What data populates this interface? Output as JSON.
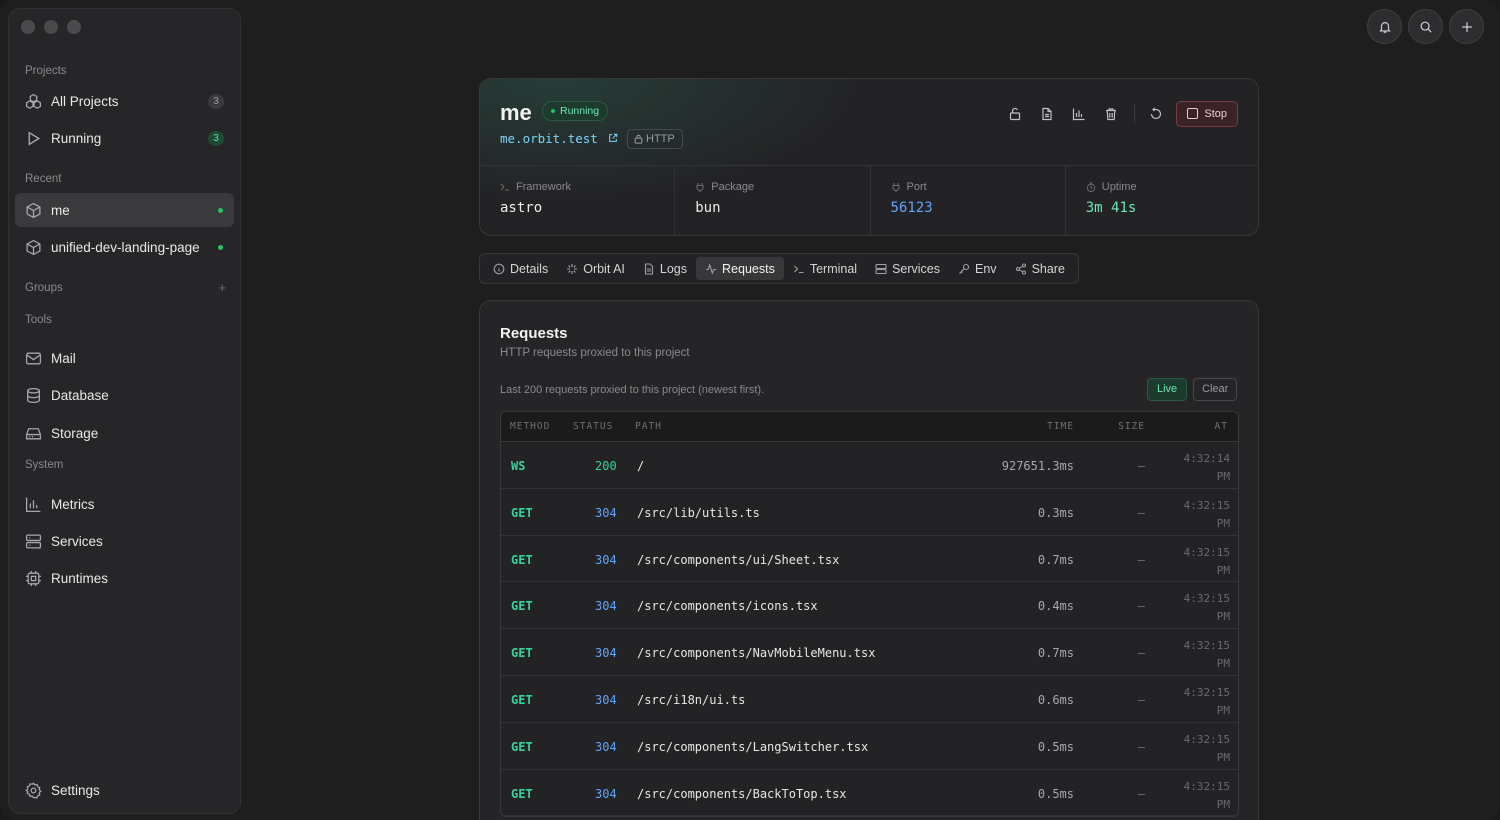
{
  "sidebar": {
    "sections": {
      "projects": "Projects",
      "recent": "Recent",
      "groups": "Groups",
      "tools": "Tools",
      "system": "System"
    },
    "projects": [
      {
        "label": "All Projects",
        "count": "3",
        "icon": "cubes-icon"
      },
      {
        "label": "Running",
        "count": "3",
        "icon": "play-icon"
      }
    ],
    "recent": [
      {
        "label": "me",
        "icon": "package-icon",
        "status": "running"
      },
      {
        "label": "unified-dev-landing-page",
        "icon": "package-icon",
        "status": "running"
      }
    ],
    "groups_add": "+",
    "tools": [
      {
        "label": "Mail",
        "icon": "mail-icon"
      },
      {
        "label": "Database",
        "icon": "database-icon"
      },
      {
        "label": "Storage",
        "icon": "storage-icon"
      }
    ],
    "system": [
      {
        "label": "Metrics",
        "icon": "bar-chart-icon"
      },
      {
        "label": "Services",
        "icon": "server-icon"
      },
      {
        "label": "Runtimes",
        "icon": "cpu-icon"
      }
    ],
    "settings": "Settings"
  },
  "project": {
    "name": "me",
    "status": "Running",
    "domain": "me.orbit.test",
    "protocol": "HTTP",
    "stop_label": "Stop",
    "stats": [
      {
        "label": "Framework",
        "value": "astro",
        "icon": "terminal-icon"
      },
      {
        "label": "Package",
        "value": "bun",
        "icon": "plug-icon"
      },
      {
        "label": "Port",
        "value": "56123",
        "icon": "plug-icon"
      },
      {
        "label": "Uptime",
        "value": "3m 41s",
        "icon": "timer-icon"
      }
    ]
  },
  "tabs": [
    {
      "label": "Details",
      "icon": "info-icon"
    },
    {
      "label": "Orbit AI",
      "icon": "sparkle-icon"
    },
    {
      "label": "Logs",
      "icon": "file-icon"
    },
    {
      "label": "Requests",
      "icon": "activity-icon",
      "active": true
    },
    {
      "label": "Terminal",
      "icon": "terminal-icon"
    },
    {
      "label": "Services",
      "icon": "server-icon"
    },
    {
      "label": "Env",
      "icon": "key-icon"
    },
    {
      "label": "Share",
      "icon": "share-icon"
    }
  ],
  "requests": {
    "title": "Requests",
    "subtitle": "HTTP requests proxied to this project",
    "note": "Last 200 requests proxied to this project (newest first).",
    "live_label": "Live",
    "clear_label": "Clear",
    "columns": [
      "METHOD",
      "STATUS",
      "PATH",
      "TIME",
      "SIZE",
      "AT"
    ],
    "rows": [
      {
        "method": "WS",
        "status": "200",
        "path": "/",
        "time": "927651.3ms",
        "size": "–",
        "at_time": "4:32:14",
        "at_ampm": "PM"
      },
      {
        "method": "GET",
        "status": "304",
        "path": "/src/lib/utils.ts",
        "time": "0.3ms",
        "size": "–",
        "at_time": "4:32:15",
        "at_ampm": "PM"
      },
      {
        "method": "GET",
        "status": "304",
        "path": "/src/components/ui/Sheet.tsx",
        "time": "0.7ms",
        "size": "–",
        "at_time": "4:32:15",
        "at_ampm": "PM"
      },
      {
        "method": "GET",
        "status": "304",
        "path": "/src/components/icons.tsx",
        "time": "0.4ms",
        "size": "–",
        "at_time": "4:32:15",
        "at_ampm": "PM"
      },
      {
        "method": "GET",
        "status": "304",
        "path": "/src/components/NavMobileMenu.tsx",
        "time": "0.7ms",
        "size": "–",
        "at_time": "4:32:15",
        "at_ampm": "PM"
      },
      {
        "method": "GET",
        "status": "304",
        "path": "/src/i18n/ui.ts",
        "time": "0.6ms",
        "size": "–",
        "at_time": "4:32:15",
        "at_ampm": "PM"
      },
      {
        "method": "GET",
        "status": "304",
        "path": "/src/components/LangSwitcher.tsx",
        "time": "0.5ms",
        "size": "–",
        "at_time": "4:32:15",
        "at_ampm": "PM"
      },
      {
        "method": "GET",
        "status": "304",
        "path": "/src/components/BackToTop.tsx",
        "time": "0.5ms",
        "size": "–",
        "at_time": "4:32:15",
        "at_ampm": "PM"
      }
    ]
  },
  "colors": {
    "accent_green": "#34d399",
    "status_blue": "#60a5fa",
    "stop_red": "#7a3a40"
  }
}
